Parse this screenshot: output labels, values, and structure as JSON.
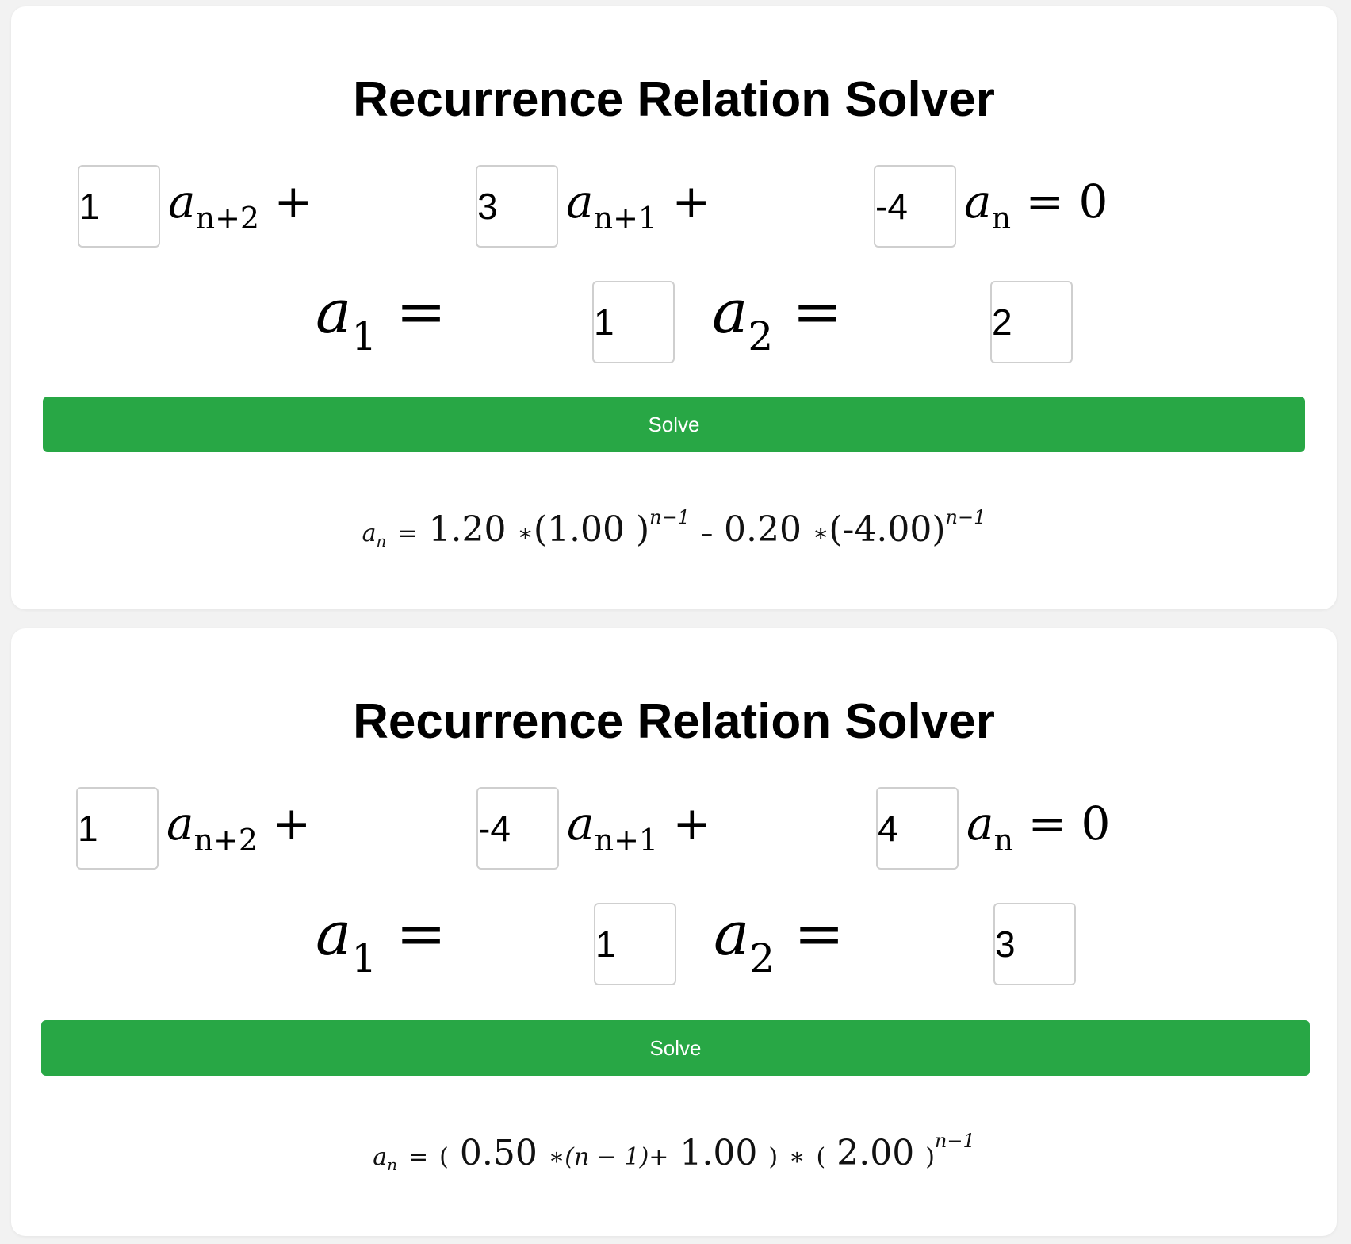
{
  "cards": [
    {
      "title": "Recurrence Relation Solver",
      "coefficients": [
        "1",
        "3",
        "-4"
      ],
      "terms": {
        "a_n2": {
          "base": "a",
          "sub": "n+2",
          "op": "+"
        },
        "a_n1": {
          "base": "a",
          "sub": "n+1",
          "op": "+"
        },
        "a_n": {
          "base": "a",
          "sub": "n",
          "op": "= 0"
        }
      },
      "initial": {
        "a1": {
          "base": "a",
          "sub": "1",
          "eq": "="
        },
        "a2": {
          "base": "a",
          "sub": "2",
          "eq": "="
        },
        "a1_value": "1",
        "a2_value": "2"
      },
      "solve_label": "Solve",
      "result": {
        "lhs": "a",
        "lhs_sub": "n",
        "eq": "=",
        "part1": "1.20",
        "star1": "∗",
        "part2": "(1.00 )",
        "exp1": "n−1",
        "minus": "–",
        "part3": "0.20",
        "star2": "∗",
        "part4": "(-4.00)",
        "exp2": "n−1"
      }
    },
    {
      "title": "Recurrence Relation Solver",
      "coefficients": [
        "1",
        "-4",
        "4"
      ],
      "terms": {
        "a_n2": {
          "base": "a",
          "sub": "n+2",
          "op": "+"
        },
        "a_n1": {
          "base": "a",
          "sub": "n+1",
          "op": "+"
        },
        "a_n": {
          "base": "a",
          "sub": "n",
          "op": "= 0"
        }
      },
      "initial": {
        "a1": {
          "base": "a",
          "sub": "1",
          "eq": "="
        },
        "a2": {
          "base": "a",
          "sub": "2",
          "eq": "="
        },
        "a1_value": "1",
        "a2_value": "3"
      },
      "solve_label": "Solve",
      "result": {
        "lhs": "a",
        "lhs_sub": "n",
        "eq": "=",
        "open1": "(",
        "part1": "0.50",
        "star1": "∗",
        "nminus": "(n − 1)+",
        "part2": "1.00",
        "close1": ")",
        "star2": "∗",
        "open2": "(",
        "part3": "2.00",
        "close2": ")",
        "exp": "n−1"
      }
    }
  ]
}
